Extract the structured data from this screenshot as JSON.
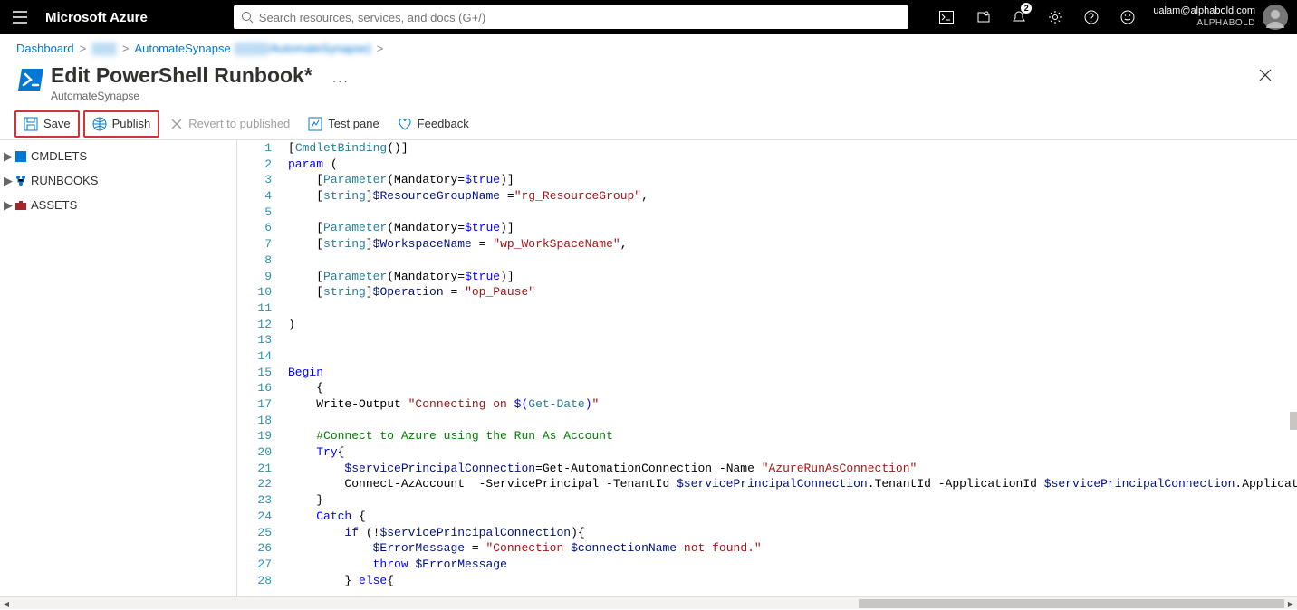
{
  "header": {
    "brand": "Microsoft Azure",
    "search_placeholder": "Search resources, services, and docs (G+/)",
    "notification_count": "2",
    "user_email": "ualam@alphabold.com",
    "user_org": "ALPHABOLD"
  },
  "breadcrumb": {
    "items": [
      "Dashboard",
      "▒▒▒",
      "AutomateSynapse",
      "▒▒▒▒/AutomateSynapse)"
    ]
  },
  "page": {
    "title": "Edit PowerShell Runbook*",
    "subtitle": "AutomateSynapse"
  },
  "toolbar": {
    "save": "Save",
    "publish": "Publish",
    "revert": "Revert to published",
    "test": "Test pane",
    "feedback": "Feedback"
  },
  "tree": {
    "items": [
      "CMDLETS",
      "RUNBOOKS",
      "ASSETS"
    ]
  },
  "code": {
    "lines": [
      {
        "n": 1,
        "segs": [
          {
            "t": "[",
            "c": "k-black"
          },
          {
            "t": "CmdletBinding",
            "c": "k-teal"
          },
          {
            "t": "()]",
            "c": "k-black"
          }
        ]
      },
      {
        "n": 2,
        "segs": [
          {
            "t": "param",
            "c": "k-blue"
          },
          {
            "t": " (",
            "c": "k-black"
          }
        ]
      },
      {
        "n": 3,
        "segs": [
          {
            "t": "    [",
            "c": "k-black"
          },
          {
            "t": "Parameter",
            "c": "k-teal"
          },
          {
            "t": "(Mandatory=",
            "c": "k-black"
          },
          {
            "t": "$true",
            "c": "k-blue"
          },
          {
            "t": ")]",
            "c": "k-black"
          }
        ]
      },
      {
        "n": 4,
        "segs": [
          {
            "t": "    [",
            "c": "k-black"
          },
          {
            "t": "string",
            "c": "k-teal"
          },
          {
            "t": "]",
            "c": "k-black"
          },
          {
            "t": "$ResourceGroupName",
            "c": "k-var"
          },
          {
            "t": " =",
            "c": "k-black"
          },
          {
            "t": "\"rg_ResourceGroup\"",
            "c": "k-str"
          },
          {
            "t": ",",
            "c": "k-black"
          }
        ]
      },
      {
        "n": 5,
        "segs": []
      },
      {
        "n": 6,
        "segs": [
          {
            "t": "    [",
            "c": "k-black"
          },
          {
            "t": "Parameter",
            "c": "k-teal"
          },
          {
            "t": "(Mandatory=",
            "c": "k-black"
          },
          {
            "t": "$true",
            "c": "k-blue"
          },
          {
            "t": ")]",
            "c": "k-black"
          }
        ]
      },
      {
        "n": 7,
        "segs": [
          {
            "t": "    [",
            "c": "k-black"
          },
          {
            "t": "string",
            "c": "k-teal"
          },
          {
            "t": "]",
            "c": "k-black"
          },
          {
            "t": "$WorkspaceName",
            "c": "k-var"
          },
          {
            "t": " = ",
            "c": "k-black"
          },
          {
            "t": "\"wp_WorkSpaceName\"",
            "c": "k-str"
          },
          {
            "t": ",",
            "c": "k-black"
          }
        ]
      },
      {
        "n": 8,
        "segs": []
      },
      {
        "n": 9,
        "segs": [
          {
            "t": "    [",
            "c": "k-black"
          },
          {
            "t": "Parameter",
            "c": "k-teal"
          },
          {
            "t": "(Mandatory=",
            "c": "k-black"
          },
          {
            "t": "$true",
            "c": "k-blue"
          },
          {
            "t": ")]",
            "c": "k-black"
          }
        ]
      },
      {
        "n": 10,
        "segs": [
          {
            "t": "    [",
            "c": "k-black"
          },
          {
            "t": "string",
            "c": "k-teal"
          },
          {
            "t": "]",
            "c": "k-black"
          },
          {
            "t": "$Operation",
            "c": "k-var"
          },
          {
            "t": " = ",
            "c": "k-black"
          },
          {
            "t": "\"op_Pause\"",
            "c": "k-str"
          }
        ]
      },
      {
        "n": 11,
        "segs": []
      },
      {
        "n": 12,
        "segs": [
          {
            "t": ")",
            "c": "k-black"
          }
        ]
      },
      {
        "n": 13,
        "segs": []
      },
      {
        "n": 14,
        "segs": []
      },
      {
        "n": 15,
        "segs": [
          {
            "t": "Begin",
            "c": "k-blue"
          }
        ]
      },
      {
        "n": 16,
        "segs": [
          {
            "t": "    {",
            "c": "k-black"
          }
        ]
      },
      {
        "n": 17,
        "segs": [
          {
            "t": "    Write-Output ",
            "c": "k-black"
          },
          {
            "t": "\"Connecting on ",
            "c": "k-str"
          },
          {
            "t": "$(",
            "c": "k-blue"
          },
          {
            "t": "Get-Date",
            "c": "k-teal"
          },
          {
            "t": ")",
            "c": "k-blue"
          },
          {
            "t": "\"",
            "c": "k-str"
          }
        ]
      },
      {
        "n": 18,
        "segs": []
      },
      {
        "n": 19,
        "segs": [
          {
            "t": "    ",
            "c": "k-black"
          },
          {
            "t": "#Connect to Azure using the Run As Account",
            "c": "k-comment"
          }
        ]
      },
      {
        "n": 20,
        "segs": [
          {
            "t": "    ",
            "c": "k-black"
          },
          {
            "t": "Try",
            "c": "k-blue"
          },
          {
            "t": "{",
            "c": "k-black"
          }
        ]
      },
      {
        "n": 21,
        "segs": [
          {
            "t": "        ",
            "c": "k-black"
          },
          {
            "t": "$servicePrincipalConnection",
            "c": "k-var"
          },
          {
            "t": "=Get-AutomationConnection -Name ",
            "c": "k-black"
          },
          {
            "t": "\"AzureRunAsConnection\"",
            "c": "k-str"
          }
        ]
      },
      {
        "n": 22,
        "segs": [
          {
            "t": "        Connect-AzAccount  -ServicePrincipal -TenantId ",
            "c": "k-black"
          },
          {
            "t": "$servicePrincipalConnection",
            "c": "k-var"
          },
          {
            "t": ".TenantId -ApplicationId ",
            "c": "k-black"
          },
          {
            "t": "$servicePrincipalConnection",
            "c": "k-var"
          },
          {
            "t": ".ApplicationId -Certi",
            "c": "k-black"
          }
        ]
      },
      {
        "n": 23,
        "segs": [
          {
            "t": "    }",
            "c": "k-black"
          }
        ]
      },
      {
        "n": 24,
        "segs": [
          {
            "t": "    ",
            "c": "k-black"
          },
          {
            "t": "Catch",
            "c": "k-blue"
          },
          {
            "t": " {",
            "c": "k-black"
          }
        ]
      },
      {
        "n": 25,
        "segs": [
          {
            "t": "        ",
            "c": "k-black"
          },
          {
            "t": "if",
            "c": "k-blue"
          },
          {
            "t": " (!",
            "c": "k-black"
          },
          {
            "t": "$servicePrincipalConnection",
            "c": "k-var"
          },
          {
            "t": "){",
            "c": "k-black"
          }
        ]
      },
      {
        "n": 26,
        "segs": [
          {
            "t": "            ",
            "c": "k-black"
          },
          {
            "t": "$ErrorMessage",
            "c": "k-var"
          },
          {
            "t": " = ",
            "c": "k-black"
          },
          {
            "t": "\"Connection ",
            "c": "k-str"
          },
          {
            "t": "$connectionName",
            "c": "k-var"
          },
          {
            "t": " not found.\"",
            "c": "k-str"
          }
        ]
      },
      {
        "n": 27,
        "segs": [
          {
            "t": "            ",
            "c": "k-black"
          },
          {
            "t": "throw",
            "c": "k-blue"
          },
          {
            "t": " ",
            "c": "k-black"
          },
          {
            "t": "$ErrorMessage",
            "c": "k-var"
          }
        ]
      },
      {
        "n": 28,
        "segs": [
          {
            "t": "        } ",
            "c": "k-black"
          },
          {
            "t": "else",
            "c": "k-blue"
          },
          {
            "t": "{",
            "c": "k-black"
          }
        ]
      }
    ]
  }
}
